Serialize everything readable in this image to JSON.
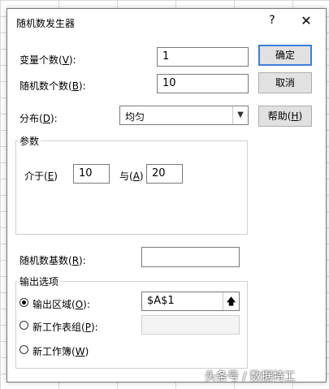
{
  "dialog": {
    "title": "随机数发生器",
    "help_glyph": "?",
    "close_glyph": "✕"
  },
  "fields": {
    "var_count": {
      "label_pre": "变量个数(",
      "key": "V",
      "label_post": "):",
      "value": "1"
    },
    "rand_count": {
      "label_pre": "随机数个数(",
      "key": "B",
      "label_post": "):",
      "value": "10"
    },
    "distribution": {
      "label_pre": "分布(",
      "key": "D",
      "label_post": "):",
      "value": "均匀"
    }
  },
  "buttons": {
    "ok": "确定",
    "cancel": "取消",
    "help_pre": "帮助(",
    "help_key": "H",
    "help_post": ")"
  },
  "params": {
    "title": "参数",
    "between_pre": "介于(",
    "between_key": "E",
    "between_post": ")",
    "between_value": "10",
    "and_pre": "与(",
    "and_key": "A",
    "and_post": ")",
    "and_value": "20"
  },
  "seed": {
    "label_pre": "随机数基数(",
    "key": "R",
    "label_post": "):",
    "value": ""
  },
  "output": {
    "title": "输出选项",
    "range_pre": "输出区域(",
    "range_key": "O",
    "range_post": "):",
    "range_value": "$A$1",
    "sheet_pre": "新工作表组(",
    "sheet_key": "P",
    "sheet_post": "):",
    "sheet_value": "",
    "book_pre": "新工作簿(",
    "book_key": "W",
    "book_post": ")",
    "ref_glyph": "🡅"
  },
  "watermark": "头条号 / 数据特工"
}
